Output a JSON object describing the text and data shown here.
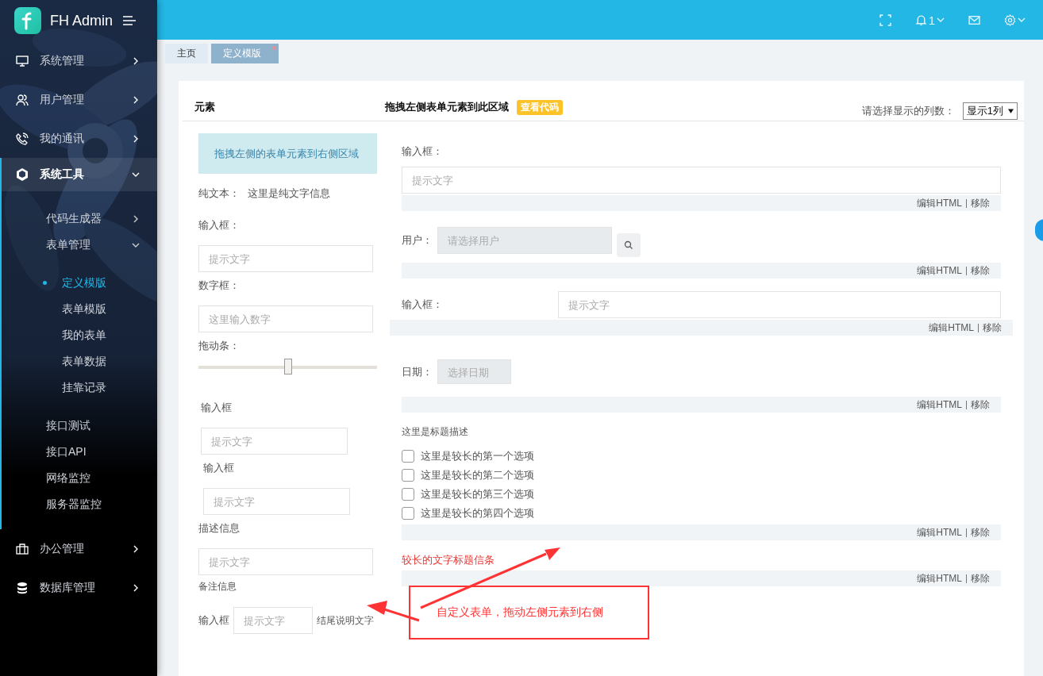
{
  "sidebar": {
    "brand": "FH Admin",
    "items": [
      {
        "label": "系统管理",
        "expanded": false
      },
      {
        "label": "用户管理",
        "expanded": false
      },
      {
        "label": "我的通讯",
        "expanded": false
      },
      {
        "label": "系统工具",
        "expanded": true,
        "children": [
          {
            "label": "代码生成器",
            "expanded": false
          },
          {
            "label": "表单管理",
            "expanded": true,
            "children": [
              {
                "label": "定义模版",
                "selected": true
              },
              {
                "label": "表单模版",
                "selected": false
              },
              {
                "label": "我的表单",
                "selected": false
              },
              {
                "label": "表单数据",
                "selected": false
              },
              {
                "label": "挂靠记录",
                "selected": false
              }
            ]
          },
          {
            "label": "接口测试"
          },
          {
            "label": "接口API"
          },
          {
            "label": "网络监控"
          },
          {
            "label": "服务器监控"
          }
        ]
      },
      {
        "label": "办公管理",
        "expanded": false
      },
      {
        "label": "数据库管理",
        "expanded": false
      }
    ]
  },
  "header": {
    "notification_count": "1"
  },
  "tabs": [
    {
      "label": "主页",
      "selected": false
    },
    {
      "label": "定义模版",
      "selected": true,
      "closable": true
    }
  ],
  "elements_panel": {
    "title": "元素",
    "items": [
      {
        "kind": "info",
        "text": "拖拽左侧的表单元素到右侧区域"
      },
      {
        "kind": "plain_text",
        "label": "纯文本：",
        "value": "这里是纯文字信息"
      },
      {
        "kind": "input",
        "label": "输入框：",
        "placeholder": "提示文字"
      },
      {
        "kind": "input",
        "label": "数字框：",
        "placeholder": "这里输入数字"
      },
      {
        "kind": "slider",
        "label": "拖动条：",
        "level": 0.5
      },
      {
        "kind": "input_small",
        "label": "输入框",
        "placeholder": "提示文字"
      },
      {
        "kind": "input_small",
        "label": "输入框",
        "placeholder": "提示文字"
      },
      {
        "kind": "input_help",
        "label": "描述信息",
        "placeholder": "提示文字",
        "help": "备注信息"
      },
      {
        "kind": "input_inline",
        "label": "输入框",
        "placeholder": "提示文字",
        "suffix": "结尾说明文字"
      }
    ]
  },
  "design_panel": {
    "title": "拖拽左侧表单元素到此区域",
    "code_badge": "查看代码",
    "columns_label": "请选择显示的列数：",
    "columns_value": "显示1列",
    "fields": [
      {
        "kind": "input_stacked",
        "label": "输入框：",
        "placeholder": "提示文字",
        "actions": [
          "编辑HTML",
          "移除"
        ]
      },
      {
        "kind": "user_picker",
        "label": "用户：",
        "placeholder": "请选择用户",
        "actions": [
          "编辑HTML",
          "移除"
        ]
      },
      {
        "kind": "input_inline",
        "label": "输入框：",
        "placeholder": "提示文字",
        "actions": [
          "编辑HTML",
          "移除"
        ]
      },
      {
        "kind": "date",
        "label": "日期：",
        "placeholder": "选择日期",
        "actions": [
          "编辑HTML",
          "移除"
        ]
      },
      {
        "kind": "checkbox_group",
        "label": "这里是标题描述",
        "options": [
          {
            "label": "这里是较长的第一个选项",
            "checked": false
          },
          {
            "label": "这里是较长的第二个选项",
            "checked": false
          },
          {
            "label": "这里是较长的第三个选项",
            "checked": false
          },
          {
            "label": "这里是较长的第四个选项",
            "checked": false
          }
        ],
        "actions": [
          "编辑HTML",
          "移除"
        ]
      },
      {
        "kind": "heading",
        "label": "较长的文字标题信条",
        "actions": [
          "编辑HTML",
          "移除"
        ]
      }
    ]
  },
  "annotation": {
    "text": "自定义表单，拖动左侧元素到右侧"
  }
}
